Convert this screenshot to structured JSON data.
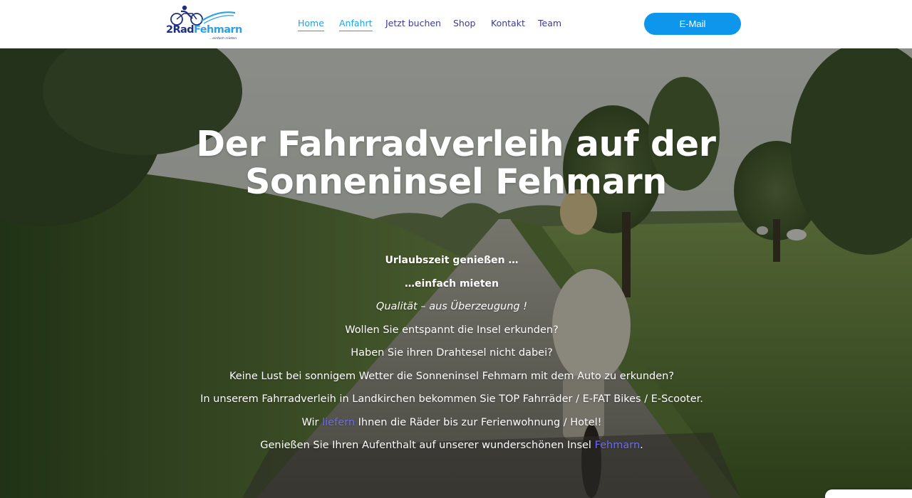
{
  "header": {
    "logo": {
      "brand_part1": "2Rad",
      "brand_part2": "Fehmarn",
      "tagline": "...einfach mieten",
      "brand_colors": {
        "dark": "#1f2f80",
        "light": "#29a3e2"
      }
    },
    "nav": [
      {
        "label": "Home",
        "active": true
      },
      {
        "label": "Anfahrt",
        "active": true
      },
      {
        "label": "Jetzt buchen",
        "active": false
      },
      {
        "label": "Shop",
        "active": false
      },
      {
        "label": "Kontakt",
        "active": false
      },
      {
        "label": "Team",
        "active": false
      }
    ],
    "email_button": "E-Mail",
    "colors": {
      "nav_text": "#3b3d8c",
      "nav_active": "#1fa3e4",
      "button_bg": "#0d96ec"
    }
  },
  "hero": {
    "title_line1": "Der Fahrradverleih auf der",
    "title_line2": "Sonneninsel Fehmarn",
    "lines": {
      "l1": "Urlaubszeit genießen …",
      "l2": "…einfach mieten",
      "l3": "Qualität – aus Überzeugung !",
      "l4": "Wollen Sie entspannt die Insel erkunden?",
      "l5": "Haben Sie ihren Drahtesel nicht dabei?",
      "l6": "Keine Lust bei sonnigem Wetter die Sonneninsel Fehmarn mit dem Auto zu erkunden?",
      "l7": "In unserem Fahrradverleih in Landkirchen bekommen Sie TOP Fahrräder / E-FAT Bikes / E-Scooter.",
      "l8_before": "Wir ",
      "l8_link": "liefern",
      "l8_after": " Ihnen die Räder bis zur Ferienwohnung / Hotel!",
      "l9_before": "Genießen Sie Ihren Aufenthalt auf unserer wunderschönen Insel ",
      "l9_link": "Fehmarn",
      "l9_after": "."
    },
    "link_color": "#6f6cf2"
  }
}
